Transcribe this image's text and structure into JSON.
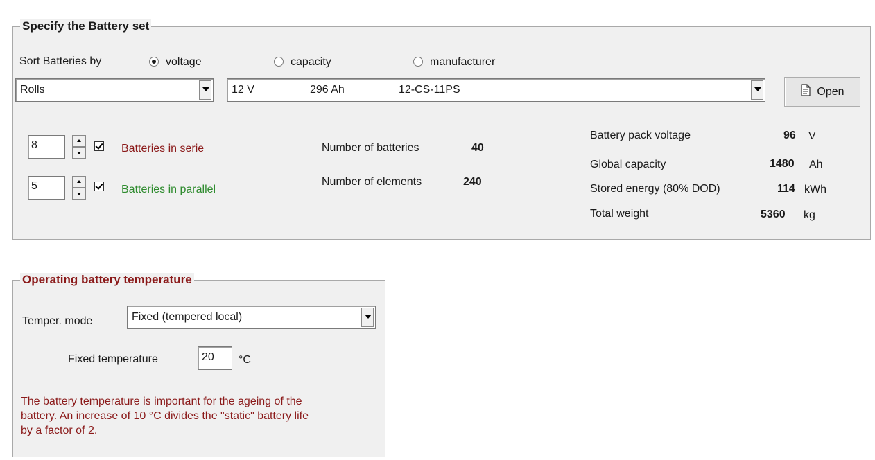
{
  "battery_set": {
    "title": "Specify the Battery set",
    "sort_label": "Sort Batteries by",
    "sort_options": [
      {
        "label": "voltage",
        "selected": true
      },
      {
        "label": "capacity",
        "selected": false
      },
      {
        "label": "manufacturer",
        "selected": false
      }
    ],
    "manufacturer": "Rolls",
    "model": {
      "voltage": "12 V",
      "capacity": "296 Ah",
      "name": "12-CS-11PS"
    },
    "open_button": {
      "prefix": "",
      "underlined": "O",
      "rest": "pen"
    },
    "series": {
      "value": "8",
      "label": "Batteries in serie",
      "checked": true,
      "color": "#8b1a1a"
    },
    "parallel": {
      "value": "5",
      "label": "Batteries in parallel",
      "checked": true,
      "color": "#2e8b2e"
    },
    "num_batteries": {
      "label": "Number of batteries",
      "value": "40"
    },
    "num_elements": {
      "label": "Number of elements",
      "value": "240"
    },
    "stats": [
      {
        "label": "Battery pack voltage",
        "value": "96",
        "unit": "V"
      },
      {
        "label": "Global capacity",
        "value": "1480",
        "unit": "Ah"
      },
      {
        "label": "Stored energy (80% DOD)",
        "value": "114",
        "unit": "kWh"
      },
      {
        "label": "Total weight",
        "value": "5360",
        "unit": "kg"
      }
    ]
  },
  "temperature": {
    "title": "Operating battery temperature",
    "title_color": "#8b1a1a",
    "mode_label": "Temper. mode",
    "mode_value": "Fixed  (tempered local)",
    "fixed_label": "Fixed temperature",
    "fixed_value": "20",
    "fixed_unit": "°C",
    "note_lines": [
      "The battery temperature is important for the ageing of the",
      "battery. An increase of 10 °C divides the \"static\" battery life",
      "by a factor of 2."
    ],
    "note_color": "#8b1a1a"
  }
}
